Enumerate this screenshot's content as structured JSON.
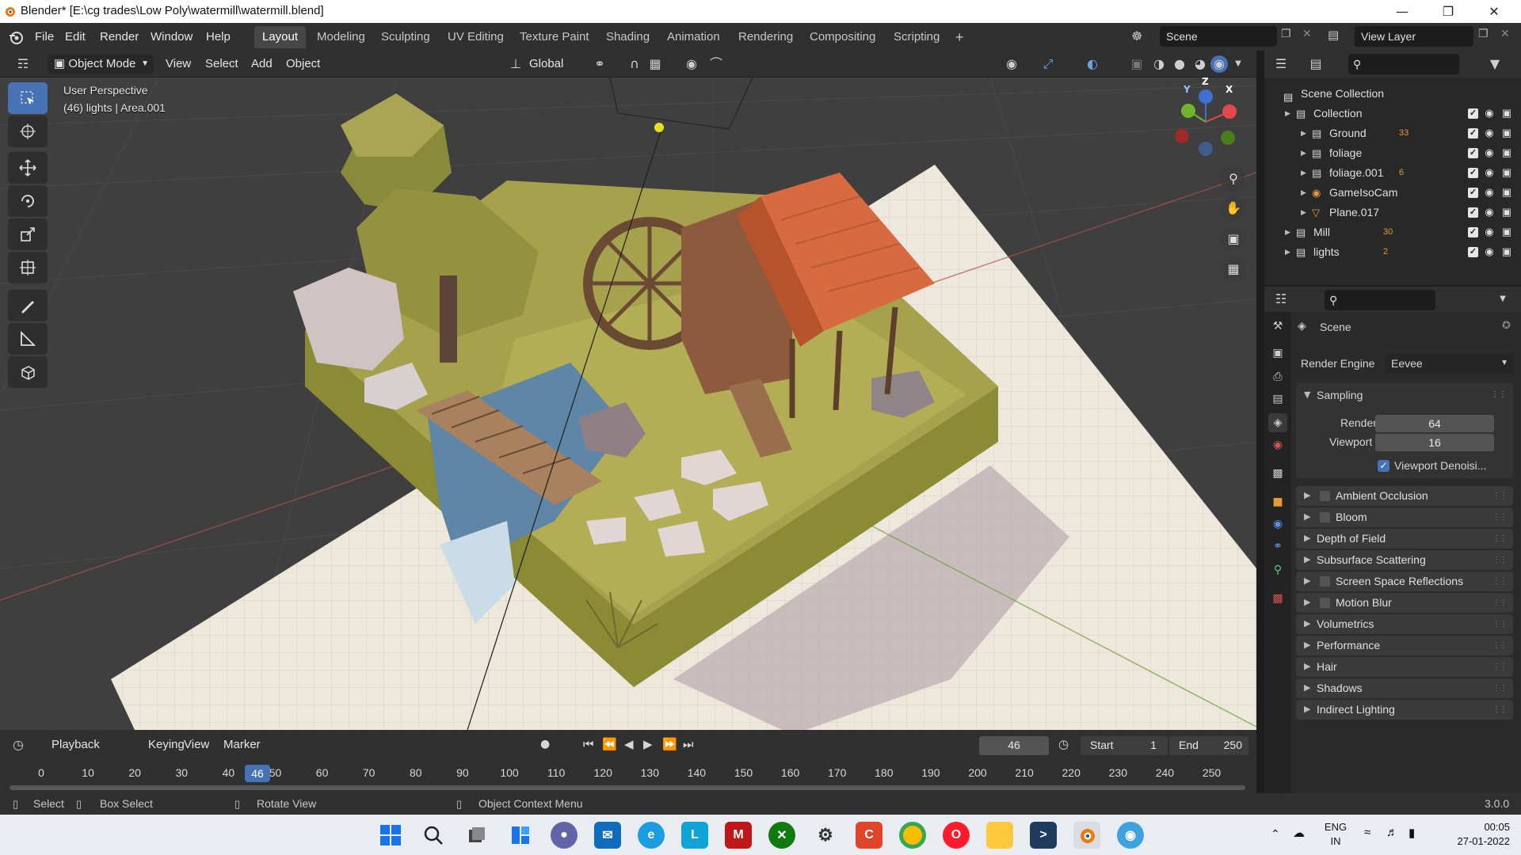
{
  "window": {
    "title": "Blender* [E:\\cg trades\\Low Poly\\watermill\\watermill.blend]",
    "controls": [
      "minimize-icon",
      "restore-icon",
      "close-icon"
    ]
  },
  "topbar": {
    "menus": [
      "File",
      "Edit",
      "Render",
      "Window",
      "Help"
    ],
    "workspaces": [
      "Layout",
      "Modeling",
      "Sculpting",
      "UV Editing",
      "Texture Paint",
      "Shading",
      "Animation",
      "Rendering",
      "Compositing",
      "Scripting"
    ],
    "active_workspace": "Layout",
    "add_workspace": "+",
    "scene_name": "Scene",
    "view_layer": "View Layer"
  },
  "viewport_header": {
    "mode": "Object Mode",
    "menus": [
      "View",
      "Select",
      "Add",
      "Object"
    ],
    "orientation": "Global"
  },
  "viewport": {
    "perspective_label": "User Perspective",
    "selection_info": "(46) lights | Area.001",
    "gizmo_axes": [
      "Y",
      "Z",
      "X"
    ],
    "tools": [
      "select-box-icon",
      "cursor-icon",
      "move-icon",
      "rotate-icon",
      "scale-icon",
      "transform-icon",
      "annotate-icon",
      "measure-icon",
      "add-cube-icon"
    ],
    "nav_buttons": [
      "zoom-icon",
      "hand-icon",
      "camera-icon",
      "grid-icon"
    ]
  },
  "outliner": {
    "root": "Scene Collection",
    "rows": [
      {
        "name": "Collection",
        "depth": 1,
        "icon": "collection-icon",
        "badge": ""
      },
      {
        "name": "Ground",
        "depth": 2,
        "icon": "collection-icon",
        "badge": "33"
      },
      {
        "name": "foliage",
        "depth": 2,
        "icon": "collection-icon",
        "badge": ""
      },
      {
        "name": "foliage.001",
        "depth": 2,
        "icon": "collection-icon",
        "badge": "6"
      },
      {
        "name": "GameIsoCam",
        "depth": 2,
        "icon": "camera-object-icon",
        "badge": ""
      },
      {
        "name": "Plane.017",
        "depth": 2,
        "icon": "mesh-icon",
        "badge": ""
      },
      {
        "name": "Mill",
        "depth": 1,
        "icon": "collection-icon",
        "badge": "30"
      },
      {
        "name": "lights",
        "depth": 1,
        "icon": "collection-icon",
        "badge": "2"
      }
    ]
  },
  "properties": {
    "context": "Scene",
    "render_engine_label": "Render Engine",
    "render_engine": "Eevee",
    "sampling": {
      "title": "Sampling",
      "render_label": "Render",
      "render": "64",
      "viewport_label": "Viewport",
      "viewport": "16",
      "denoise_label": "Viewport Denoisi..."
    },
    "sections": [
      {
        "label": "Ambient Occlusion",
        "has_checkbox": true
      },
      {
        "label": "Bloom",
        "has_checkbox": true
      },
      {
        "label": "Depth of Field",
        "has_checkbox": false
      },
      {
        "label": "Subsurface Scattering",
        "has_checkbox": false
      },
      {
        "label": "Screen Space Reflections",
        "has_checkbox": true
      },
      {
        "label": "Motion Blur",
        "has_checkbox": true
      },
      {
        "label": "Volumetrics",
        "has_checkbox": false
      },
      {
        "label": "Performance",
        "has_checkbox": false
      },
      {
        "label": "Hair",
        "has_checkbox": false
      },
      {
        "label": "Shadows",
        "has_checkbox": false
      },
      {
        "label": "Indirect Lighting",
        "has_checkbox": false
      }
    ]
  },
  "timeline": {
    "menus": [
      "Playback",
      "Keying",
      "View",
      "Marker"
    ],
    "current_frame": "46",
    "start_label": "Start",
    "start": "1",
    "end_label": "End",
    "end": "250",
    "ticks": [
      "0",
      "10",
      "20",
      "30",
      "40",
      "50",
      "60",
      "70",
      "80",
      "90",
      "100",
      "110",
      "120",
      "130",
      "140",
      "150",
      "160",
      "170",
      "180",
      "190",
      "200",
      "210",
      "220",
      "230",
      "240",
      "250"
    ]
  },
  "statusbar": {
    "select": "Select",
    "box_select": "Box Select",
    "rotate_view": "Rotate View",
    "context_menu": "Object Context Menu",
    "version": "3.0.0"
  },
  "taskbar": {
    "language": "ENG",
    "region": "IN",
    "time": "00:05",
    "date": "27-01-2022",
    "apps": [
      "windows-start-icon",
      "search-icon",
      "task-view-icon",
      "widgets-icon",
      "teams-chat-icon",
      "mail-icon",
      "edge-icon",
      "l-app-icon",
      "mcafee-icon",
      "xbox-icon",
      "settings-icon",
      "c-app-icon",
      "chrome-icon",
      "opera-icon",
      "file-explorer-icon",
      "terminal-icon",
      "blender-icon",
      "earth-app-icon"
    ]
  },
  "colors": {
    "accent": "#4772b3",
    "ground": "#a5a14c",
    "roof": "#d86a3f",
    "floor": "#eee7dc"
  }
}
